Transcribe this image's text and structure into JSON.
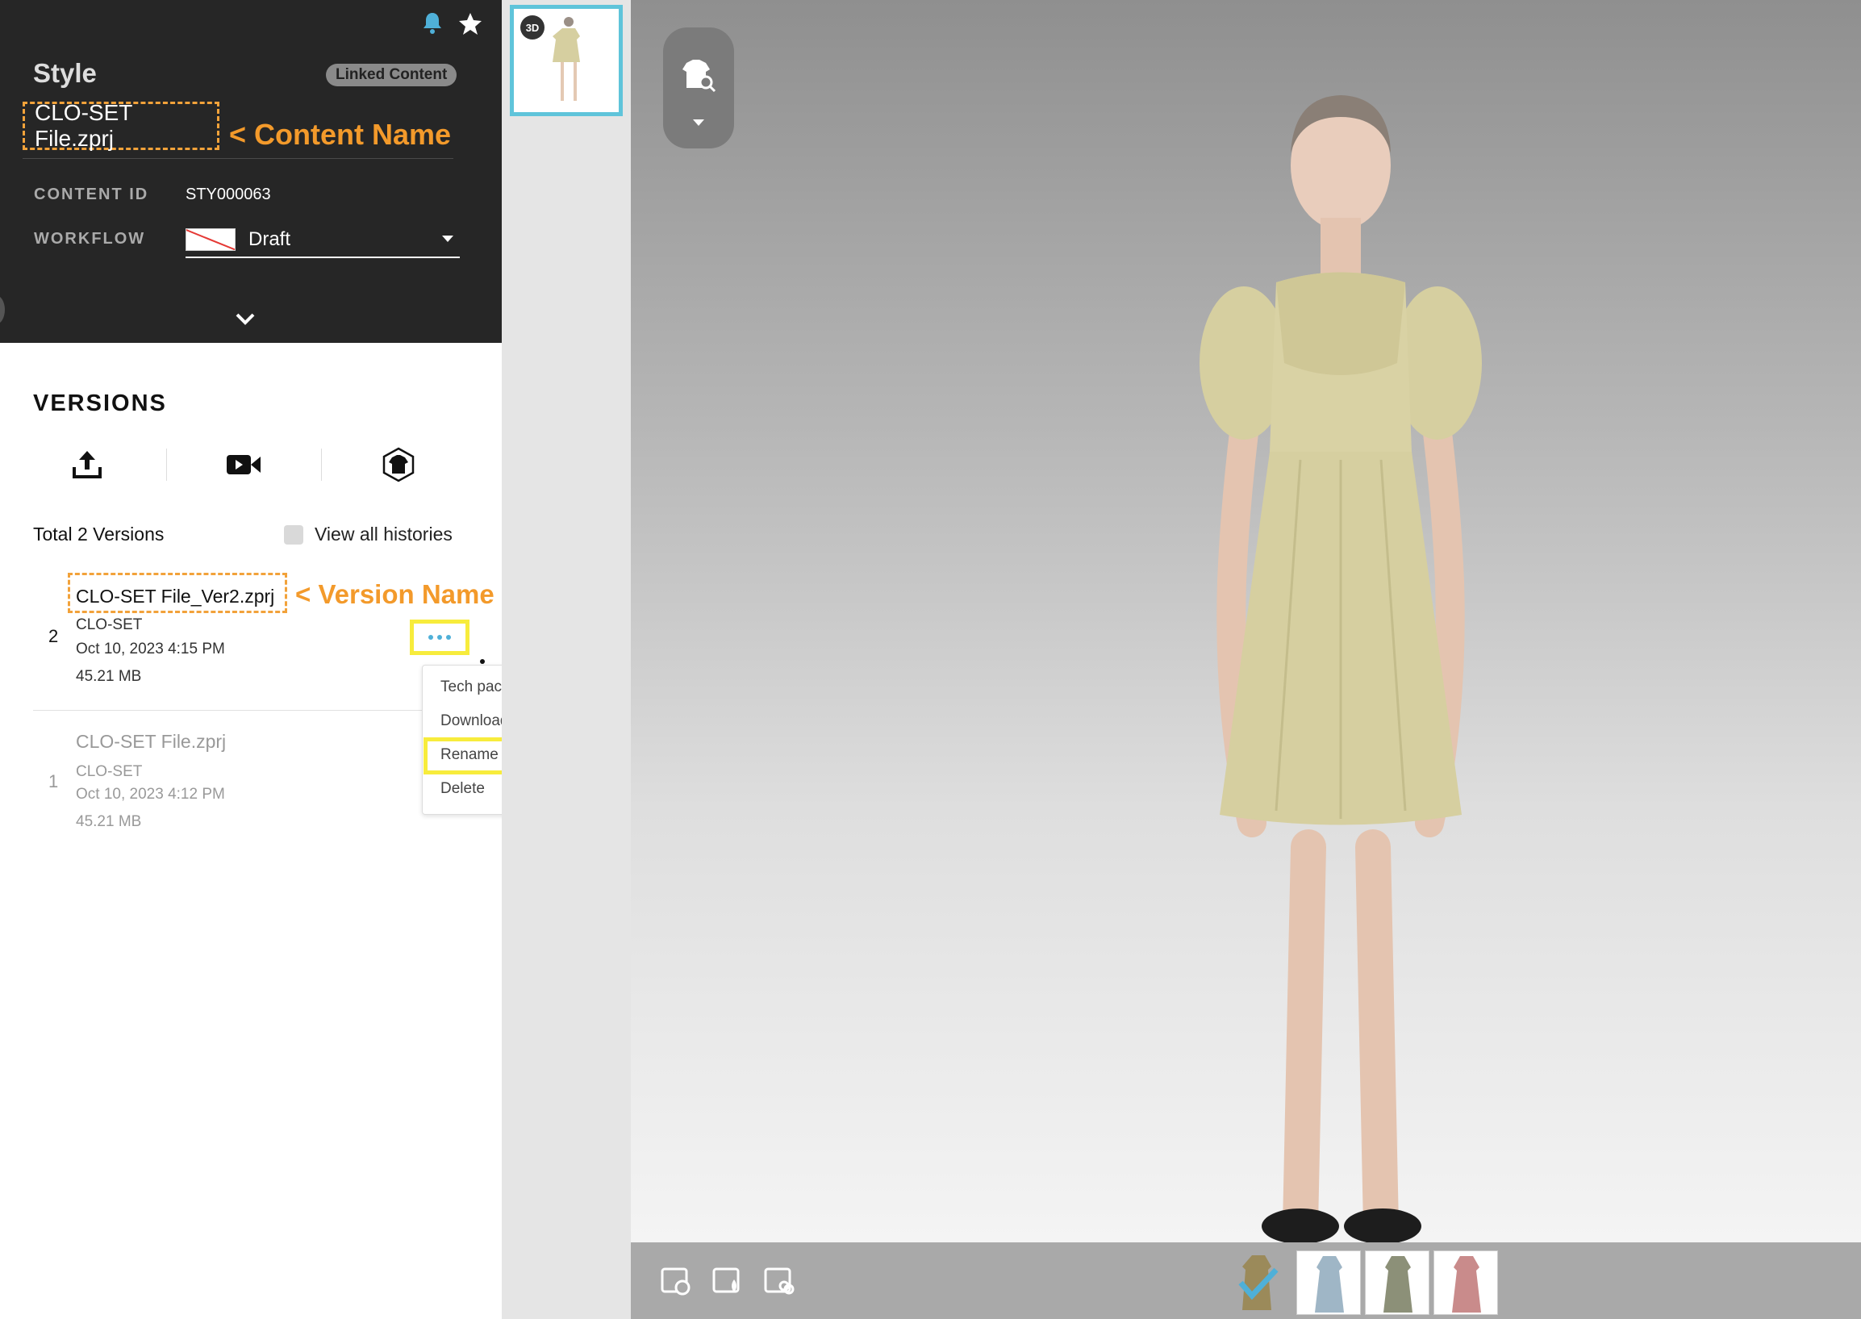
{
  "style_panel": {
    "title": "Style",
    "badge": "Linked Content",
    "content_name": "CLO-SET File.zprj",
    "content_id_label": "CONTENT ID",
    "content_id_value": "STY000063",
    "workflow_label": "WORKFLOW",
    "workflow_value": "Draft"
  },
  "annotations": {
    "content_name": "< Content Name",
    "version_name": "< Version Name"
  },
  "versions": {
    "title": "VERSIONS",
    "total": "Total 2 Versions",
    "view_all_label": "View all histories",
    "items": [
      {
        "number": "2",
        "name": "CLO-SET File_Ver2.zprj",
        "author": "CLO-SET",
        "date": "Oct 10, 2023 4:15 PM",
        "size": "45.21 MB"
      },
      {
        "number": "1",
        "name": "CLO-SET File.zprj",
        "author": "CLO-SET",
        "date": "Oct 10, 2023 4:12 PM",
        "size": "45.21 MB"
      }
    ]
  },
  "context_menu": {
    "items": [
      "Tech pack",
      "Download...",
      "Rename",
      "Delete"
    ]
  },
  "thumbnail": {
    "badge": "3D"
  },
  "colorways": {
    "swatches": [
      "#9b8a5a",
      "#9fb6c6",
      "#8c9078",
      "#c98b8b"
    ],
    "selected_index": 0
  },
  "colors": {
    "accent": "#5fc4da",
    "annotation": "#f39a2b",
    "highlight": "#f7ec3c",
    "dress": "#d6cfa0"
  }
}
